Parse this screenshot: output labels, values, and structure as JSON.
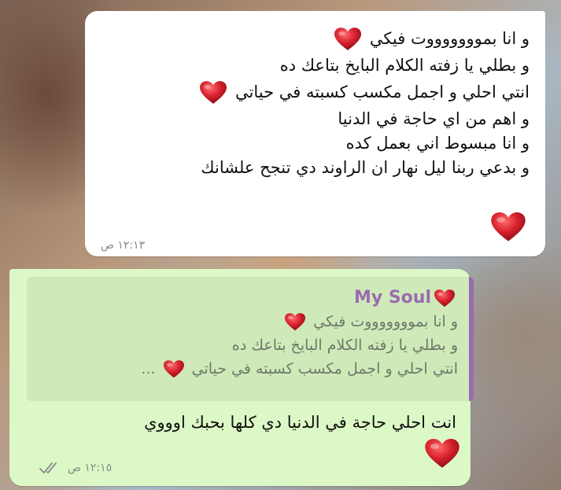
{
  "incoming_message": {
    "lines": [
      "و انا بموووووووت فيكي",
      "و بطلي يا زفته الكلام البايخ بتاعك ده",
      "انتي احلي و اجمل مكسب كسبته في حياتي",
      "و اهم من اي حاجة في الدنيا",
      " و انا مبسوط اني بعمل كده",
      "و بدعي ربنا ليل نهار ان الراوند دي تنجح علشانك"
    ],
    "time": "١٢:١٣ ص"
  },
  "outgoing_message": {
    "quote": {
      "sender": "My Soul",
      "lines": [
        "و انا بموووووووت فيكي",
        "و بطلي يا زفته الكلام البايخ بتاعك ده",
        "انتي احلي و اجمل مكسب كسبته في حياتي",
        "..."
      ]
    },
    "text": "انت احلي حاجة في الدنيا دي كلها بحبك اوووي",
    "time": "١٢:١٥ ص"
  },
  "icons": {
    "heart": "red-heart-emoji",
    "read_receipt": "double-check-icon"
  },
  "colors": {
    "incoming_bg": "#ffffff",
    "outgoing_bg": "#dcf8c6",
    "quote_accent": "#9b6bb0",
    "heart": "#d61f2c"
  }
}
